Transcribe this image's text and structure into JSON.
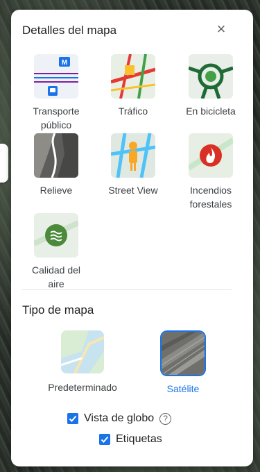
{
  "panel": {
    "title": "Detalles del mapa",
    "close_icon": "×"
  },
  "layers": [
    {
      "label_line1": "Transporte",
      "label_line2": "público",
      "icon": "transit-icon"
    },
    {
      "label_line1": "Tráfico",
      "label_line2": "",
      "icon": "traffic-icon"
    },
    {
      "label_line1": "En bicicleta",
      "label_line2": "",
      "icon": "biking-icon"
    },
    {
      "label_line1": "Relieve",
      "label_line2": "",
      "icon": "terrain-icon"
    },
    {
      "label_line1": "Street View",
      "label_line2": "",
      "icon": "street-view-icon"
    },
    {
      "label_line1": "Incendios",
      "label_line2": "forestales",
      "icon": "wildfire-icon"
    },
    {
      "label_line1": "Calidad del",
      "label_line2": "aire",
      "icon": "air-quality-icon"
    }
  ],
  "map_type": {
    "title": "Tipo de mapa",
    "options": [
      {
        "label": "Predeterminado",
        "selected": false
      },
      {
        "label": "Satélite",
        "selected": true
      }
    ]
  },
  "options": {
    "globe_label": "Vista de globo",
    "globe_checked": true,
    "help_symbol": "?",
    "labels_label": "Etiquetas",
    "labels_checked": true
  },
  "colors": {
    "accent": "#1a73e8",
    "transit_blue": "#1a73e8",
    "traffic_red": "#e53935",
    "traffic_yellow": "#fbc02d",
    "bike_green": "#1e6b36",
    "wildfire_red": "#d93025",
    "air_green": "#4a8a3a"
  }
}
